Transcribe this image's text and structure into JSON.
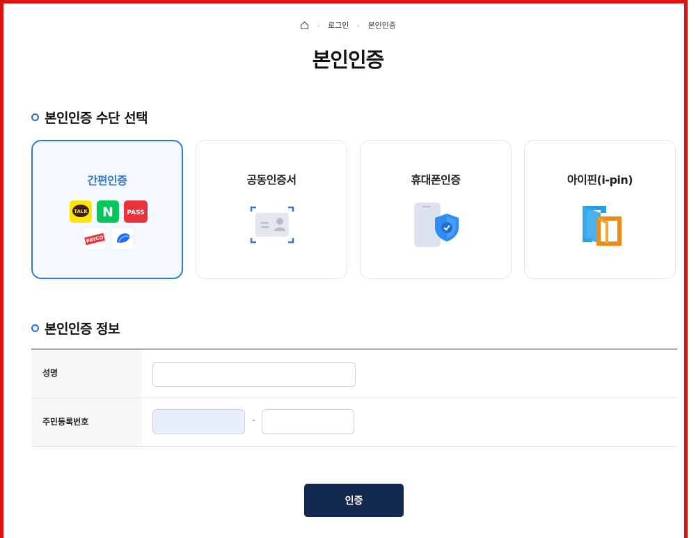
{
  "breadcrumb": {
    "home_icon": "home-icon",
    "items": [
      "로그인",
      "본인인증"
    ]
  },
  "page_title": "본인인증",
  "method_section": {
    "title": "본인인증 수단 선택",
    "cards": [
      {
        "label": "간편인증",
        "selected": true,
        "icons": [
          "kakao-talk-icon",
          "naver-icon",
          "pass-icon",
          "payco-icon",
          "toss-icon"
        ],
        "icon_text": {
          "talk": "TALK",
          "naver": "N",
          "pass": "PASS",
          "payco": "PAYCO"
        }
      },
      {
        "label": "공동인증서",
        "selected": false,
        "icons": [
          "certificate-icon"
        ]
      },
      {
        "label": "휴대폰인증",
        "selected": false,
        "icons": [
          "phone-shield-icon"
        ]
      },
      {
        "label": "아이핀(i-pin)",
        "selected": false,
        "icons": [
          "ipin-icon"
        ]
      }
    ]
  },
  "info_section": {
    "title": "본인인증 정보",
    "name_label": "성명",
    "name_value": "",
    "rrn_label": "주민등록번호",
    "rrn_front_value": "",
    "rrn_separator": "-",
    "rrn_back_value": ""
  },
  "submit_label": "인증",
  "colors": {
    "accent": "#2f78d8",
    "submit_bg": "#13294f",
    "frame": "#e01010"
  }
}
